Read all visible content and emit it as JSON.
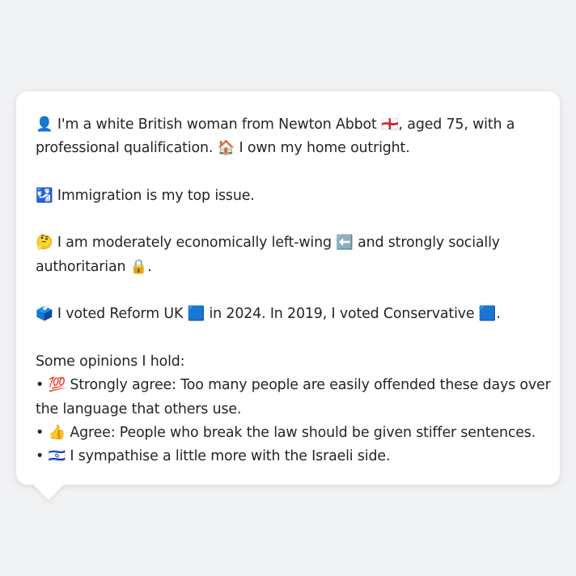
{
  "profile": {
    "line1a": "👤 I'm a white British woman from Newton Abbot 🏴󠁧󠁢󠁥󠁮󠁧󠁿, aged 75, with a",
    "line1b": "professional qualification. 🏠 I own my home outright.",
    "line2": "🛂 Immigration is my top issue.",
    "line3a": "🤔 I am moderately economically left-wing ⬅️ and strongly socially",
    "line3b": "authoritarian 🔒.",
    "line4": "🗳️ I voted Reform UK 🟦 in 2024. In 2019, I voted Conservative 🟦.",
    "opinions_heading": "Some opinions I hold:",
    "opinion1a": "• 💯 Strongly agree: Too many people are easily offended these days over",
    "opinion1b": "the language that others use.",
    "opinion2": "• 👍 Agree: People who break the law should be given stiffer sentences.",
    "opinion3": "• 🇮🇱 I sympathise a little more with the Israeli side."
  }
}
